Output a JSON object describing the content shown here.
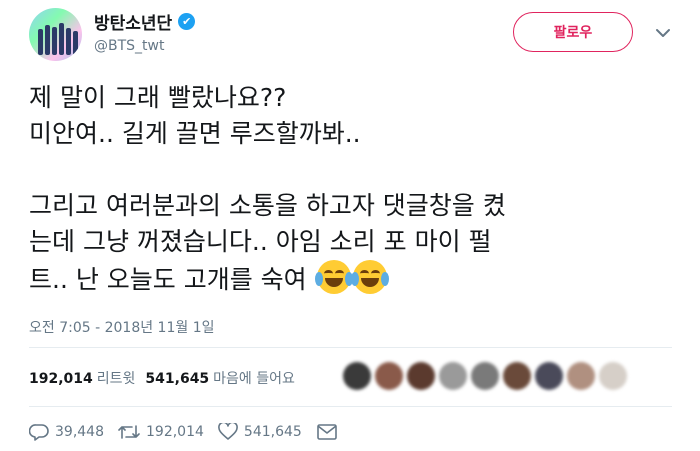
{
  "tweet": {
    "author": {
      "display_name": "방탄소년단",
      "handle": "@BTS_twt",
      "verified_icon": "✔"
    },
    "follow_label": "팔로우",
    "text_lines": [
      "제 말이 그래 빨랐나요??",
      "미안여.. 길게 끌면 루즈할까봐..",
      "",
      "그리고 여러분과의 소통을 하고자 댓글창을 켰",
      "는데 그냥 꺼졌습니다.. 아임 소리 포 마이 펄",
      "트.. 난 오늘도 고개를 숙여"
    ],
    "emojis": [
      "face-with-tears-of-joy",
      "face-with-tears-of-joy"
    ],
    "timestamp": "오전 7:05 - 2018년 11월 1일",
    "stats": {
      "retweets_count": "192,014",
      "retweets_label": "리트윗",
      "likes_count": "541,645",
      "likes_label": "마음에 들어요"
    },
    "liker_avatars_colors": [
      "#3a3a3a",
      "#8a5a4a",
      "#5b3a2e",
      "#9a9a9a",
      "#7a7a7a",
      "#6a4a3a",
      "#4a4a5a",
      "#b09080",
      "#d6cfc8"
    ],
    "actions": {
      "reply_count": "39,448",
      "retweet_count": "192,014",
      "like_count": "541,645"
    },
    "colors": {
      "accent": "#e0245e",
      "verified": "#1da1f2",
      "secondary_text": "#657786"
    }
  }
}
